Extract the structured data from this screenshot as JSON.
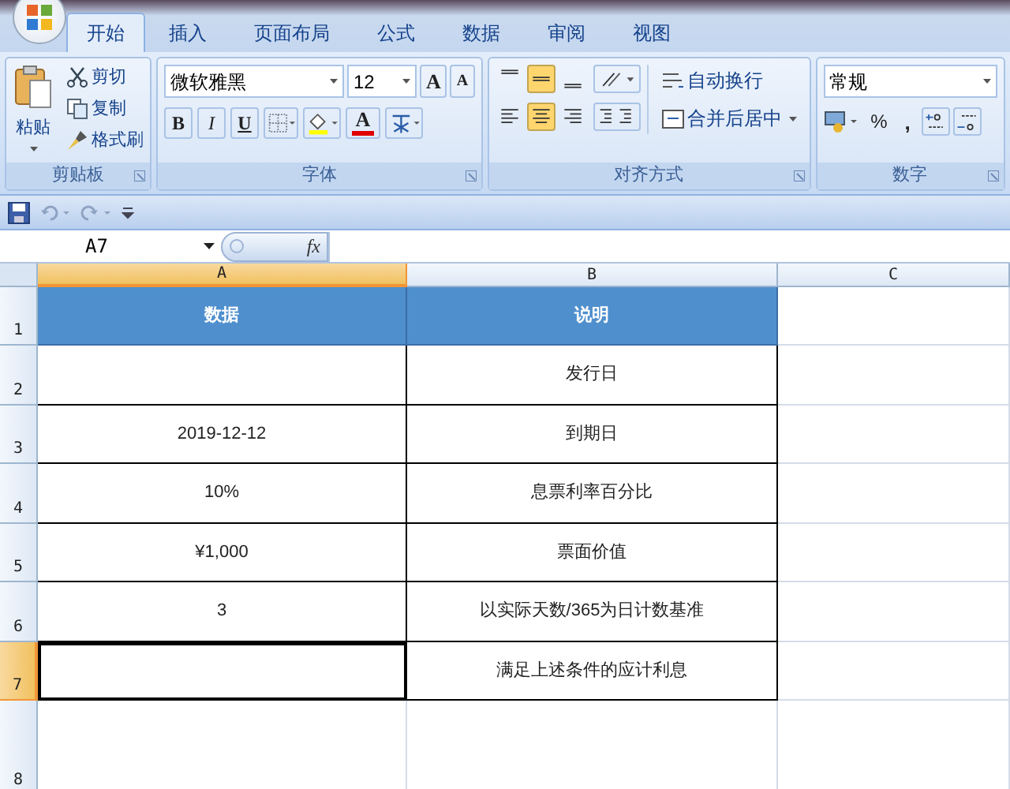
{
  "tabs": [
    {
      "label": "开始",
      "selected": true
    },
    {
      "label": "插入",
      "selected": false
    },
    {
      "label": "页面布局",
      "selected": false
    },
    {
      "label": "公式",
      "selected": false
    },
    {
      "label": "数据",
      "selected": false
    },
    {
      "label": "审阅",
      "selected": false
    },
    {
      "label": "视图",
      "selected": false
    }
  ],
  "ribbon": {
    "clipboard": {
      "label": "剪贴板",
      "paste": "粘贴",
      "cut": "剪切",
      "copy": "复制",
      "format_painter": "格式刷"
    },
    "font": {
      "label": "字体",
      "font_name": "微软雅黑",
      "font_size": "12",
      "grow": "A",
      "shrink": "A",
      "bold": "B",
      "italic": "I",
      "underline": "U",
      "font_color_letter": "A"
    },
    "alignment": {
      "label": "对齐方式",
      "wrap_text": "自动换行",
      "merge_center": "合并后居中",
      "vertical": [
        {
          "selected": false
        },
        {
          "selected": true
        },
        {
          "selected": false
        }
      ],
      "horizontal": [
        {
          "selected": false
        },
        {
          "selected": true
        },
        {
          "selected": false
        }
      ]
    },
    "number": {
      "label": "数字",
      "format": "常规",
      "percent": "%",
      "comma": ","
    }
  },
  "formula_bar": {
    "name_box": "A7",
    "fx": "fx"
  },
  "sheet": {
    "columns": [
      {
        "label": "A",
        "selected": true
      },
      {
        "label": "B",
        "selected": false
      },
      {
        "label": "C",
        "selected": false
      }
    ],
    "rows": [
      {
        "header": "1",
        "kind": "header",
        "selected": false,
        "cells": [
          "数据",
          "说明"
        ]
      },
      {
        "header": "2",
        "kind": "data",
        "selected": false,
        "cells": [
          "",
          "发行日"
        ]
      },
      {
        "header": "3",
        "kind": "data",
        "selected": false,
        "cells": [
          "2019-12-12",
          "到期日"
        ]
      },
      {
        "header": "4",
        "kind": "data",
        "selected": false,
        "cells": [
          "10%",
          "息票利率百分比"
        ]
      },
      {
        "header": "5",
        "kind": "data",
        "selected": false,
        "cells": [
          "¥1,000",
          "票面价值"
        ]
      },
      {
        "header": "6",
        "kind": "data",
        "selected": false,
        "cells": [
          "3",
          "以实际天数/365为日计数基准"
        ]
      },
      {
        "header": "7",
        "kind": "data",
        "selected": true,
        "cells": [
          "",
          "满足上述条件的应计利息"
        ]
      },
      {
        "header": "8",
        "kind": "empty",
        "selected": false,
        "cells": []
      }
    ]
  }
}
